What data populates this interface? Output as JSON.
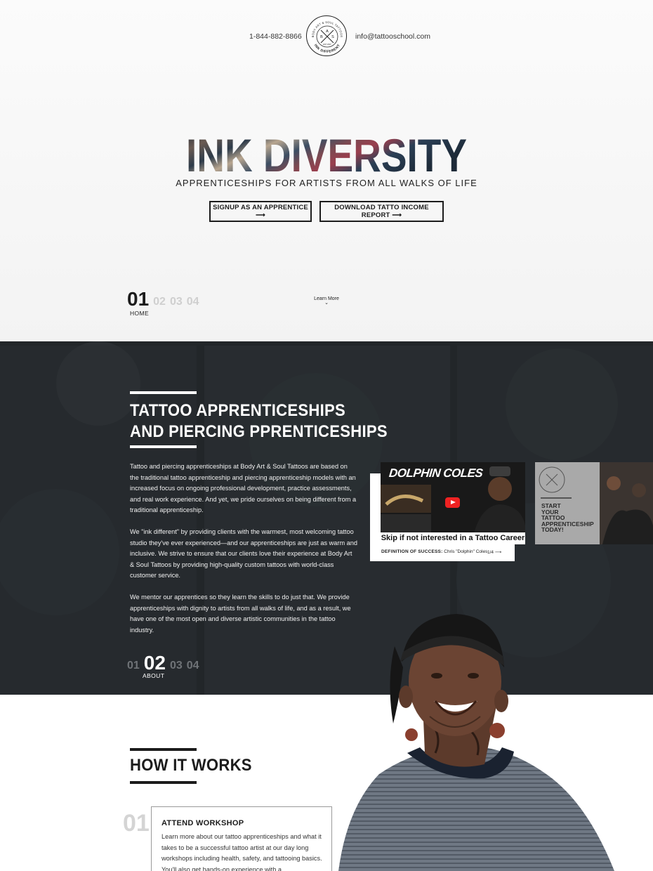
{
  "header": {
    "phone": "1-844-882-8866",
    "email": "info@tattooschool.com",
    "logo": {
      "ring_text_top": "BODY ART & SOUL TATTOOS",
      "ring_text_bottom": "INK DIFFERENT",
      "letters": [
        "A",
        "B",
        "S"
      ],
      "est": "EST 2007",
      "icon": "crossed-needles-icon"
    }
  },
  "hero": {
    "title": "INK DIVERSITY",
    "subtitle": "APPRENTICESHIPS FOR ARTISTS FROM ALL WALKS OF LIFE",
    "buttons": [
      {
        "label": "SIGNUP AS AN APPRENTICE ⟶"
      },
      {
        "label": "DOWNLOAD TATTO INCOME REPORT ⟶"
      }
    ],
    "pager": {
      "current": "01",
      "others": [
        "02",
        "03",
        "04"
      ],
      "label": "HOME"
    },
    "learn_more": "Learn More",
    "learn_more_icon": "chevron-down-icon"
  },
  "about": {
    "title_lines": [
      "TATTOO APPRENTICESHIPS",
      "AND PIERCING PPRENTICESHIPS"
    ],
    "paragraphs": [
      "Tattoo and piercing apprenticeships at Body Art & Soul Tattoos are based on the traditional tattoo apprenticeship and piercing apprenticeship models with an increased focus on ongoing professional development, practice assessments, and real work experience. And yet, we pride ourselves on being different from a traditional apprenticeship.",
      "We \"ink different\" by providing clients with the warmest, most welcoming tattoo studio they've ever experienced—and our apprenticeships are just as warm and inclusive. We strive to ensure that our clients love their experience at Body Art & Soul Tattoos by providing high-quality custom tattoos with world-class customer service.",
      "We mentor our apprentices so they learn the skills to do just that. We provide apprenticeships with dignity to artists from all walks of life, and as a result, we have one of the most open and diverse artistic communities in the tattoo industry."
    ],
    "pager": {
      "before": [
        "01"
      ],
      "current": "02",
      "after": [
        "03",
        "04"
      ],
      "label": "ABOUT"
    },
    "video": {
      "title": "DOLPHIN COLES",
      "caption": "Skip if not interested in a Tattoo Career",
      "definition_label": "DEFINITION OF SUCCESS:",
      "definition_value": "Chris \"Dolphin\" Coles",
      "counter": "1/4 ⟶",
      "play_icon": "play-icon"
    },
    "promo": {
      "lines": [
        "START",
        "YOUR",
        "TATTOO",
        "APPRENTICESHIP",
        "TODAY!"
      ]
    }
  },
  "how_it_works": {
    "title": "HOW IT WORKS",
    "steps": [
      {
        "number": "01",
        "title": "ATTEND WORKSHOP",
        "description": "Learn more about our tattoo apprenticeships and what it takes to be a successful tattoo artist at our day long workshops including health, safety, and tattooing basics. You'll also get hands-on experience with a"
      }
    ]
  },
  "colors": {
    "dark_section": "#232629",
    "text_dark": "#1c1c1c",
    "muted_number": "#d4d4d4",
    "video_red": "#ee2222"
  }
}
